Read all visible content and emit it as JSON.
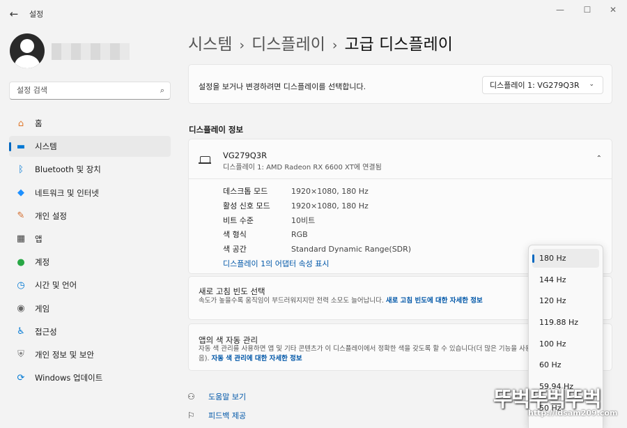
{
  "window": {
    "title": "설정",
    "back_icon": "←",
    "minimize_icon": "—",
    "maximize_icon": "☐",
    "close_icon": "✕"
  },
  "sidebar": {
    "search_placeholder": "설정 검색",
    "search_icon": "⌕",
    "items": [
      {
        "label": "홈",
        "icon": "home-icon",
        "glyph": "⌂",
        "color": "#e07b30",
        "active": false
      },
      {
        "label": "시스템",
        "icon": "monitor-icon",
        "glyph": "▬",
        "color": "#0078d4",
        "active": true
      },
      {
        "label": "Bluetooth 및 장치",
        "icon": "bluetooth-icon",
        "glyph": "ᛒ",
        "color": "#0078d4",
        "active": false
      },
      {
        "label": "네트워크 및 인터넷",
        "icon": "wifi-icon",
        "glyph": "◆",
        "color": "#1e90ff",
        "active": false
      },
      {
        "label": "개인 설정",
        "icon": "brush-icon",
        "glyph": "✎",
        "color": "#d36b2b",
        "active": false
      },
      {
        "label": "앱",
        "icon": "apps-icon",
        "glyph": "▦",
        "color": "#444444",
        "active": false
      },
      {
        "label": "계정",
        "icon": "person-icon",
        "glyph": "●",
        "color": "#28a745",
        "active": false
      },
      {
        "label": "시간 및 언어",
        "icon": "clock-globe-icon",
        "glyph": "◷",
        "color": "#0078d4",
        "active": false
      },
      {
        "label": "게임",
        "icon": "gamepad-icon",
        "glyph": "◉",
        "color": "#666666",
        "active": false
      },
      {
        "label": "접근성",
        "icon": "accessibility-icon",
        "glyph": "♿",
        "color": "#0078d4",
        "active": false
      },
      {
        "label": "개인 정보 및 보안",
        "icon": "shield-icon",
        "glyph": "⛨",
        "color": "#777777",
        "active": false
      },
      {
        "label": "Windows 업데이트",
        "icon": "update-icon",
        "glyph": "⟳",
        "color": "#0078d4",
        "active": false
      }
    ]
  },
  "breadcrumb": {
    "items": [
      "시스템",
      "디스플레이",
      "고급 디스플레이"
    ],
    "separator": "›"
  },
  "display_select": {
    "label": "설정을 보거나 변경하려면 디스플레이를 선택합니다.",
    "value": "디스플레이 1: VG279Q3R",
    "chevron": "⌄"
  },
  "display_info": {
    "section_title": "디스플레이 정보",
    "monitor_name": "VG279Q3R",
    "monitor_sub": "디스플레이 1: AMD Radeon RX 6600 XT에 연결됨",
    "collapse_icon": "⌃",
    "rows": [
      {
        "key": "데스크톱 모드",
        "value": "1920×1080, 180 Hz"
      },
      {
        "key": "활성 신호 모드",
        "value": "1920×1080, 180 Hz"
      },
      {
        "key": "비트 수준",
        "value": "10비트"
      },
      {
        "key": "색 형식",
        "value": "RGB"
      },
      {
        "key": "색 공간",
        "value": "Standard Dynamic Range(SDR)"
      }
    ],
    "adapter_link": "디스플레이 1의 어댑터 속성 표시"
  },
  "refresh_rate": {
    "title": "새로 고침 빈도 선택",
    "desc": "속도가 높을수록 움직임이 부드러워지지만 전력 소모도 늘어납니다. ",
    "link": "새로 고침 빈도에 대한 자세한 정보",
    "options": [
      "180 Hz",
      "144 Hz",
      "120 Hz",
      "119.88 Hz",
      "100 Hz",
      "60 Hz",
      "59.94 Hz",
      "50 Hz"
    ],
    "selected": "180 Hz"
  },
  "auto_color": {
    "title": "앱의 색 자동 관리",
    "desc": "자동 색 관리를 사용하면 앱 및 기타 콘텐츠가 이 디스플레이에서 정확한 색을 갖도록 할 수 있습니다(더 많은 기능을 사용할 수 있음). ",
    "link": "자동 색 관리에 대한 자세한 정보"
  },
  "footer": {
    "help": "도움말 보기",
    "feedback": "피드백 제공"
  },
  "watermark": {
    "title": "뚜벅뚜벅뚜벅",
    "url": "http://ldsam209.com"
  },
  "colors": {
    "accent": "#0067c0",
    "link": "#0057a8"
  }
}
